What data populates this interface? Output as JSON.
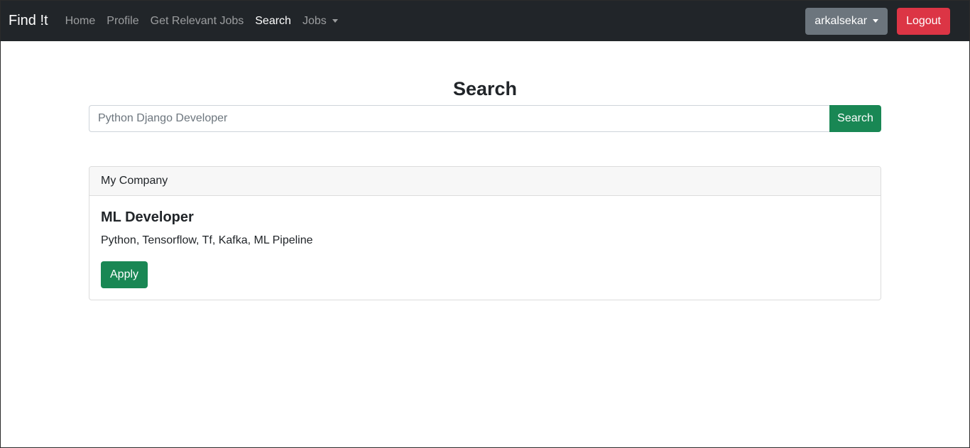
{
  "navbar": {
    "brand": "Find !t",
    "links": [
      {
        "label": "Home"
      },
      {
        "label": "Profile"
      },
      {
        "label": "Get Relevant Jobs"
      },
      {
        "label": "Search"
      },
      {
        "label": "Jobs"
      }
    ],
    "active_link": "Search",
    "user_menu_label": "arkalsekar",
    "logout_label": "Logout"
  },
  "main": {
    "title": "Search",
    "search": {
      "placeholder": "Python Django Developer",
      "value": "",
      "button_label": "Search"
    },
    "results": [
      {
        "company": "My Company",
        "job_title": "ML Developer",
        "skills": "Python, Tensorflow, Tf, Kafka, ML Pipeline",
        "apply_label": "Apply"
      }
    ]
  },
  "colors": {
    "navbar_bg": "#212529",
    "primary_green": "#198754",
    "danger_red": "#dc3545",
    "secondary_gray": "#6c757d"
  }
}
